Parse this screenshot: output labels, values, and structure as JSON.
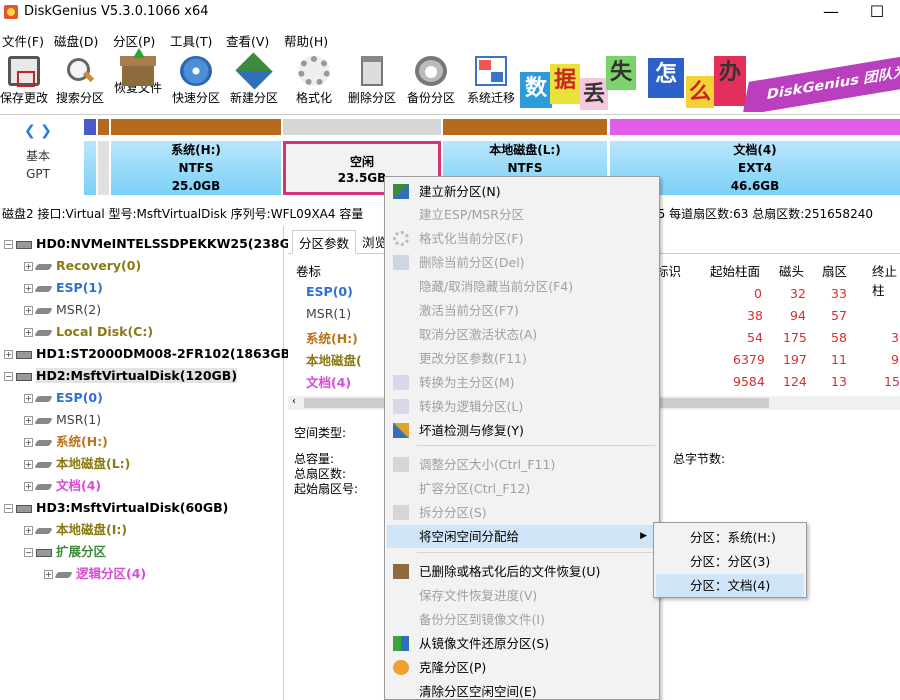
{
  "window": {
    "title": "DiskGenius V5.3.0.1066 x64",
    "minimize": "—",
    "maximize": "☐"
  },
  "menu": [
    "文件(F)",
    "磁盘(D)",
    "分区(P)",
    "工具(T)",
    "查看(V)",
    "帮助(H)"
  ],
  "toolbar": [
    {
      "label": "保存更改",
      "icon": "save-icon"
    },
    {
      "label": "搜索分区",
      "icon": "search-icon"
    },
    {
      "label": "恢复文件",
      "icon": "recover-icon"
    },
    {
      "label": "快速分区",
      "icon": "quick-partition-icon"
    },
    {
      "label": "新建分区",
      "icon": "new-partition-icon"
    },
    {
      "label": "格式化",
      "icon": "format-icon"
    },
    {
      "label": "删除分区",
      "icon": "delete-icon"
    },
    {
      "label": "备份分区",
      "icon": "backup-icon"
    },
    {
      "label": "系统迁移",
      "icon": "migrate-icon"
    }
  ],
  "banner": {
    "tiles": [
      "数",
      "据",
      "丢",
      "失",
      "怎",
      "么",
      "办"
    ],
    "ribbon": "DiskGenius 团队为"
  },
  "diskmap": {
    "label_line1": "基本",
    "label_line2": "GPT",
    "segments": [
      {
        "name": "系统(H:)",
        "fs": "NTFS",
        "size": "25.0GB"
      },
      {
        "name": "空闲",
        "fs": "",
        "size": "23.5GB"
      },
      {
        "name": "本地磁盘(L:)",
        "fs": "NTFS",
        "size": ""
      },
      {
        "name": "文档(4)",
        "fs": "EXT4",
        "size": "46.6GB"
      }
    ]
  },
  "infobar": "磁盘2 接口:Virtual  型号:MsftVirtualDisk  序列号:WFL09XA4  容量",
  "infobar_right": "55  每道扇区数:63  总扇区数:251658240",
  "tree": [
    {
      "label": "HD0:NVMeINTELSSDPEKKW25(238GB)",
      "kind": "disk"
    },
    {
      "label": "Recovery(0)",
      "kind": "part"
    },
    {
      "label": "ESP(1)",
      "kind": "part"
    },
    {
      "label": "MSR(2)",
      "kind": "part"
    },
    {
      "label": "Local Disk(C:)",
      "kind": "part"
    },
    {
      "label": "HD1:ST2000DM008-2FR102(1863GB)",
      "kind": "disk"
    },
    {
      "label": "HD2:MsftVirtualDisk(120GB)",
      "kind": "disk"
    },
    {
      "label": "ESP(0)",
      "kind": "part"
    },
    {
      "label": "MSR(1)",
      "kind": "part"
    },
    {
      "label": "系统(H:)",
      "kind": "part"
    },
    {
      "label": "本地磁盘(L:)",
      "kind": "part"
    },
    {
      "label": "文档(4)",
      "kind": "part"
    },
    {
      "label": "HD3:MsftVirtualDisk(60GB)",
      "kind": "disk"
    },
    {
      "label": "本地磁盘(I:)",
      "kind": "part"
    },
    {
      "label": "扩展分区",
      "kind": "part"
    },
    {
      "label": "逻辑分区(4)",
      "kind": "part"
    }
  ],
  "tabs": [
    "分区参数",
    "浏览"
  ],
  "table": {
    "headers": [
      "卷标",
      "标识",
      "起始柱面",
      "磁头",
      "扇区",
      "终止柱"
    ],
    "rows": [
      {
        "label": "ESP(0)",
        "cyl": "0",
        "head": "32",
        "sec": "33",
        "end": ""
      },
      {
        "label": "MSR(1)",
        "cyl": "38",
        "head": "94",
        "sec": "57",
        "end": ""
      },
      {
        "label": "系统(H:)",
        "cyl": "54",
        "head": "175",
        "sec": "58",
        "end": "3"
      },
      {
        "label": "本地磁盘(",
        "cyl": "6379",
        "head": "197",
        "sec": "11",
        "end": "9"
      },
      {
        "label": "文档(4)",
        "cyl": "9584",
        "head": "124",
        "sec": "13",
        "end": "15"
      }
    ]
  },
  "details": {
    "space_type": "空间类型:",
    "total_capacity": "总容量:",
    "total_sectors": "总扇区数:",
    "start_sector": "起始扇区号:",
    "total_bytes": "总字节数:"
  },
  "context_menu": [
    {
      "label": "建立新分区(N)",
      "enabled": true,
      "icon": "new-partition-icon"
    },
    {
      "label": "建立ESP/MSR分区",
      "enabled": false,
      "icon": ""
    },
    {
      "label": "格式化当前分区(F)",
      "enabled": false,
      "icon": "format-icon"
    },
    {
      "label": "删除当前分区(Del)",
      "enabled": false,
      "icon": "delete-icon"
    },
    {
      "label": "隐藏/取消隐藏当前分区(F4)",
      "enabled": false,
      "icon": ""
    },
    {
      "label": "激活当前分区(F7)",
      "enabled": false,
      "icon": ""
    },
    {
      "label": "取消分区激活状态(A)",
      "enabled": false,
      "icon": ""
    },
    {
      "label": "更改分区参数(F11)",
      "enabled": false,
      "icon": ""
    },
    {
      "label": "转换为主分区(M)",
      "enabled": false,
      "icon": "convert-icon"
    },
    {
      "label": "转换为逻辑分区(L)",
      "enabled": false,
      "icon": "convert-icon"
    },
    {
      "label": "坏道检测与修复(Y)",
      "enabled": true,
      "icon": "repair-icon"
    },
    {
      "label": "调整分区大小(Ctrl_F11)",
      "enabled": false,
      "icon": "resize-icon"
    },
    {
      "label": "扩容分区(Ctrl_F12)",
      "enabled": false,
      "icon": ""
    },
    {
      "label": "拆分分区(S)",
      "enabled": false,
      "icon": "split-icon"
    },
    {
      "label": "将空闲空间分配给",
      "enabled": true,
      "icon": ""
    },
    {
      "label": "已删除或格式化后的文件恢复(U)",
      "enabled": true,
      "icon": "recover-icon"
    },
    {
      "label": "保存文件恢复进度(V)",
      "enabled": false,
      "icon": ""
    },
    {
      "label": "备份分区到镜像文件(I)",
      "enabled": false,
      "icon": ""
    },
    {
      "label": "从镜像文件还原分区(S)",
      "enabled": true,
      "icon": "restore-icon"
    },
    {
      "label": "克隆分区(P)",
      "enabled": true,
      "icon": "clone-icon"
    },
    {
      "label": "清除分区空闲空间(E)",
      "enabled": true,
      "icon": ""
    }
  ],
  "submenu": [
    "分区：系统(H:)",
    "分区：分区(3)",
    "分区：文档(4)"
  ],
  "colors": {
    "accent_highlight": "#d0e6f8",
    "free_space_border": "#d6317a",
    "ntfs_cap": "#b66a1e",
    "ext4_cap": "#e35ee8"
  }
}
